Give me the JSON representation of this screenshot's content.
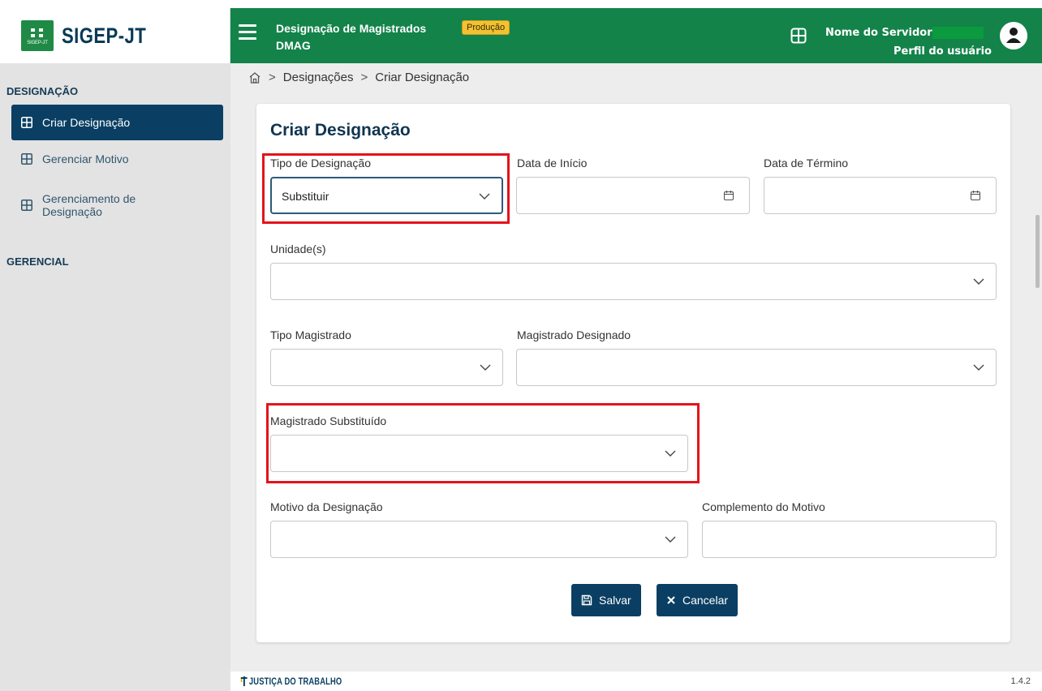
{
  "app": {
    "logo_text": "SIGEP-JT",
    "logo_mini": "SIGEP-JT",
    "title": "Designação de Magistrados",
    "subtitle": "DMAG",
    "env_badge": "Produção",
    "user_name": "Nome do Servidor",
    "user_role": "Perfil do usuário"
  },
  "sidebar": {
    "sections": [
      {
        "title": "DESIGNAÇÃO"
      },
      {
        "title": "GERENCIAL"
      }
    ],
    "items": [
      {
        "label": "Criar Designação",
        "active": true,
        "icon": "grid-icon"
      },
      {
        "label": "Gerenciar Motivo",
        "active": false,
        "icon": "grid-icon"
      },
      {
        "label_line1": "Gerenciamento de",
        "label_line2": "Designação",
        "active": false,
        "icon": "grid-icon"
      }
    ]
  },
  "breadcrumb": {
    "home_icon": "home-icon",
    "items": [
      "Designações",
      "Criar Designação"
    ]
  },
  "form": {
    "title": "Criar Designação",
    "tipo_designacao": {
      "label": "Tipo de Designação",
      "value": "Substituir"
    },
    "data_inicio": {
      "label": "Data de Início",
      "value": ""
    },
    "data_termino": {
      "label": "Data de Término",
      "value": ""
    },
    "unidades": {
      "label": "Unidade(s)",
      "value": ""
    },
    "tipo_magistrado": {
      "label": "Tipo Magistrado",
      "value": ""
    },
    "magistrado_designado": {
      "label": "Magistrado Designado",
      "value": ""
    },
    "magistrado_substituido": {
      "label": "Magistrado Substituído",
      "value": ""
    },
    "motivo": {
      "label": "Motivo da Designação",
      "value": ""
    },
    "complemento": {
      "label": "Complemento do Motivo",
      "value": ""
    },
    "save_label": "Salvar",
    "cancel_label": "Cancelar"
  },
  "footer": {
    "logo_text": "JUSTIÇA DO TRABALHO",
    "version": "1.4.2"
  },
  "colors": {
    "header_green": "#13834a",
    "primary_navy": "#0a3f63",
    "highlight_red": "#e3141b",
    "badge_yellow": "#f2c233"
  }
}
